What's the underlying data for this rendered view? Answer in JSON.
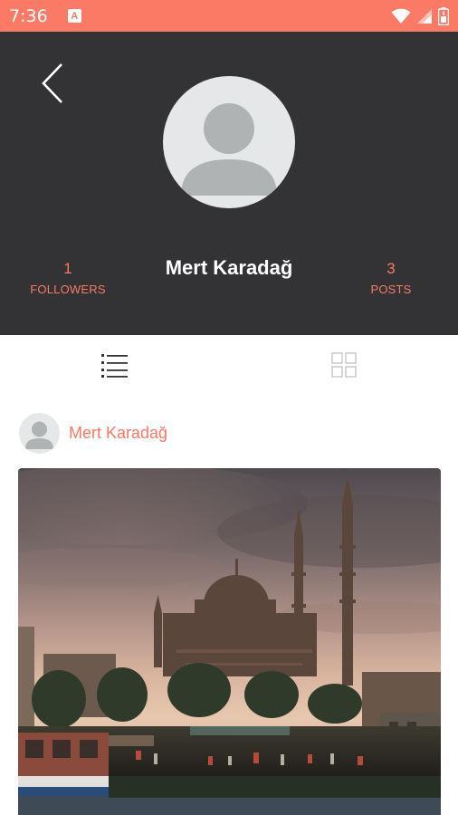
{
  "status_bar": {
    "time": "7:36",
    "notification_icon": "a-badge-icon",
    "icons": [
      "wifi-icon",
      "signal-icon",
      "battery-icon"
    ]
  },
  "colors": {
    "accent": "#fa7a66",
    "header_bg": "#333336",
    "avatar_placeholder": "#e6e7e8"
  },
  "profile": {
    "name": "Mert Karadağ",
    "followers": {
      "value": "1",
      "label": "FOLLOWERS"
    },
    "posts": {
      "value": "3",
      "label": "POSTS"
    }
  },
  "tabs": [
    {
      "icon": "list-view-icon",
      "active": true
    },
    {
      "icon": "grid-view-icon",
      "active": false
    }
  ],
  "post": {
    "author": "Mert Karadağ",
    "image": "mosque-sunset-photo"
  }
}
